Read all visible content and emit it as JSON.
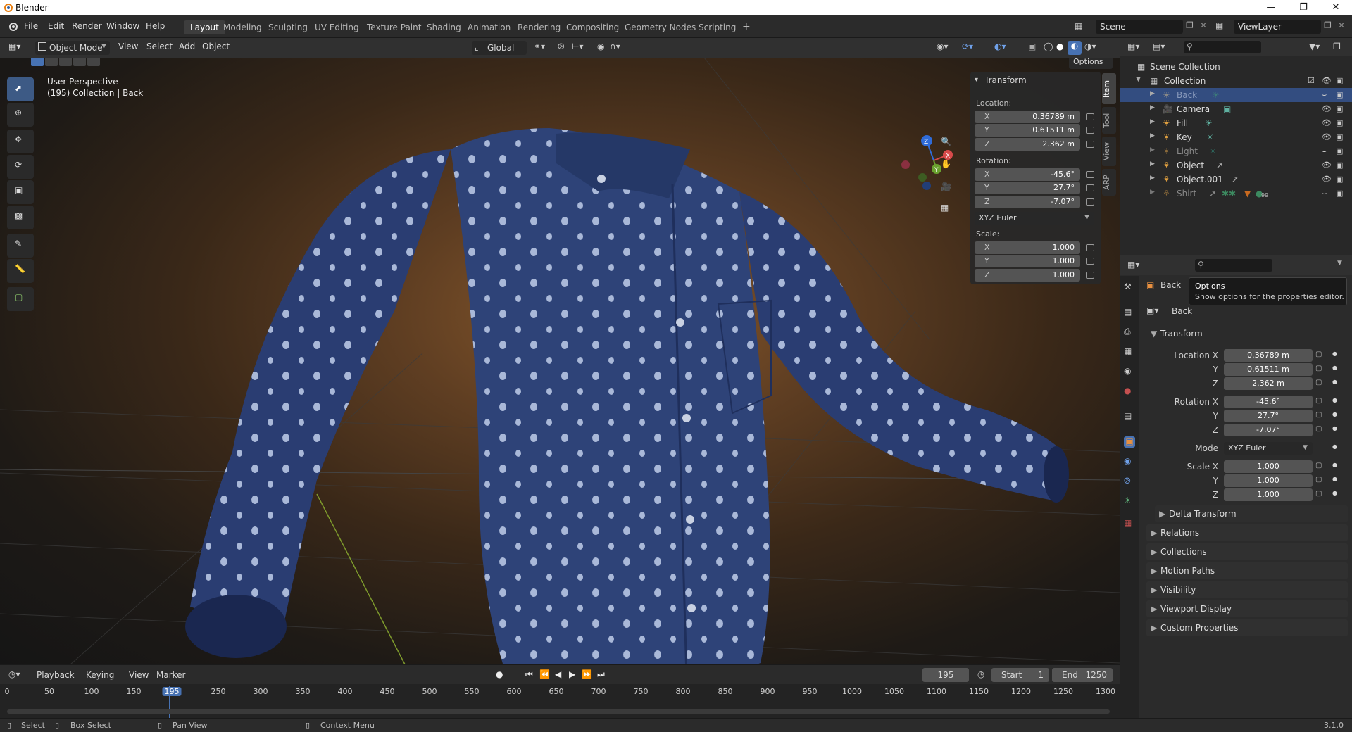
{
  "app": {
    "title": "Blender",
    "version": "3.1.0"
  },
  "menus": [
    "File",
    "Edit",
    "Render",
    "Window",
    "Help"
  ],
  "workspaces": [
    "Layout",
    "Modeling",
    "Sculpting",
    "UV Editing",
    "Texture Paint",
    "Shading",
    "Animation",
    "Rendering",
    "Compositing",
    "Geometry Nodes",
    "Scripting"
  ],
  "active_workspace": "Layout",
  "scene": {
    "name": "Scene",
    "view_layer": "ViewLayer"
  },
  "viewport_header": {
    "mode": "Object Mode",
    "menus": [
      "View",
      "Select",
      "Add",
      "Object"
    ],
    "orientation": "Global",
    "options": "Options"
  },
  "viewport": {
    "perspective": "User Perspective",
    "collection_info": "(195) Collection | Back"
  },
  "npanel": {
    "title": "Transform",
    "location_label": "Location:",
    "rotation_label": "Rotation:",
    "scale_label": "Scale:",
    "location": [
      {
        "axis": "X",
        "value": "0.36789 m"
      },
      {
        "axis": "Y",
        "value": "0.61511 m"
      },
      {
        "axis": "Z",
        "value": "2.362 m"
      }
    ],
    "rotation": [
      {
        "axis": "X",
        "value": "-45.6°"
      },
      {
        "axis": "Y",
        "value": "27.7°"
      },
      {
        "axis": "Z",
        "value": "-7.07°"
      }
    ],
    "rotation_mode": "XYZ Euler",
    "scale": [
      {
        "axis": "X",
        "value": "1.000"
      },
      {
        "axis": "Y",
        "value": "1.000"
      },
      {
        "axis": "Z",
        "value": "1.000"
      }
    ],
    "tabs": [
      "Item",
      "Tool",
      "View",
      "ARP"
    ]
  },
  "gizmo": {
    "x": "X",
    "y": "Y",
    "z": "Z"
  },
  "outliner": {
    "root": "Scene Collection",
    "collection": "Collection",
    "items": [
      "Back",
      "Camera",
      "Fill",
      "Key",
      "Light",
      "Object",
      "Object.001",
      "Shirt"
    ],
    "shirt_badge": "99"
  },
  "properties": {
    "object_name": "Back",
    "data_name": "Back",
    "tooltip_title": "Options",
    "tooltip_text": "Show options for the properties editor.",
    "transform_title": "Transform",
    "location_x_label": "Location X",
    "location_x": "0.36789 m",
    "location_y_label": "Y",
    "location_y": "0.61511 m",
    "location_z_label": "Z",
    "location_z": "2.362 m",
    "rotation_x_label": "Rotation X",
    "rotation_x": "-45.6°",
    "rotation_y_label": "Y",
    "rotation_y": "27.7°",
    "rotation_z_label": "Z",
    "rotation_z": "-7.07°",
    "mode_label": "Mode",
    "mode": "XYZ Euler",
    "scale_x_label": "Scale X",
    "scale_x": "1.000",
    "scale_y_label": "Y",
    "scale_y": "1.000",
    "scale_z_label": "Z",
    "scale_z": "1.000",
    "delta": "Delta Transform",
    "sections": [
      "Relations",
      "Collections",
      "Motion Paths",
      "Visibility",
      "Viewport Display",
      "Custom Properties"
    ]
  },
  "timeline": {
    "menus": [
      "Playback",
      "Keying",
      "View",
      "Marker"
    ],
    "current_frame": "195",
    "start_label": "Start",
    "start": "1",
    "end_label": "End",
    "end": "1250",
    "ticks": [
      "0",
      "50",
      "100",
      "150",
      "195",
      "250",
      "300",
      "350",
      "400",
      "450",
      "500",
      "550",
      "600",
      "650",
      "700",
      "750",
      "800",
      "850",
      "900",
      "950",
      "1000",
      "1050",
      "1100",
      "1150",
      "1200",
      "1250",
      "1300"
    ]
  },
  "status": {
    "select": "Select",
    "box_select": "Box Select",
    "pan_view": "Pan View",
    "context_menu": "Context Menu"
  },
  "colors": {
    "accent": "#4772b3",
    "selection": "#334d80",
    "shirt": "#2a3d72",
    "dot": "#a9b8d8"
  }
}
